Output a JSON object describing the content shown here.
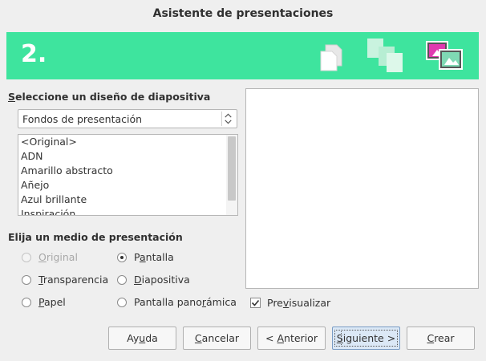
{
  "window": {
    "title": "Asistente de presentaciones"
  },
  "banner": {
    "step": "2.",
    "color": "#3ee49e",
    "icons": [
      "single-page-icon",
      "multiple-pages-icon",
      "image-slides-icon"
    ]
  },
  "design": {
    "label_mnemonic": "S",
    "label_rest": "eleccione un diseño de diapositiva",
    "select_value": "Fondos de presentación",
    "list_items": [
      "<Original>",
      "ADN",
      "Amarillo abstracto",
      "Añejo",
      "Azul brillante",
      "Inspiración"
    ]
  },
  "medium": {
    "label": "Elija un medio de presentación",
    "options": [
      {
        "pre": "",
        "mn": "O",
        "post": "riginal",
        "selected": false,
        "disabled": true
      },
      {
        "pre": "",
        "mn": "T",
        "post": "ransparencia",
        "selected": false,
        "disabled": false
      },
      {
        "pre": "",
        "mn": "P",
        "post": "apel",
        "selected": false,
        "disabled": false
      },
      {
        "pre": "P",
        "mn": "a",
        "post": "ntalla",
        "selected": true,
        "disabled": false
      },
      {
        "pre": "",
        "mn": "D",
        "post": "iapositiva",
        "selected": false,
        "disabled": false
      },
      {
        "pre": "Pantalla pano",
        "mn": "r",
        "post": "ámica",
        "selected": false,
        "disabled": false
      }
    ]
  },
  "preview": {
    "checkbox_pre": "Pre",
    "checkbox_mn": "v",
    "checkbox_post": "isualizar",
    "checked": true
  },
  "buttons": {
    "help_pre": "Ay",
    "help_mn": "u",
    "help_post": "da",
    "cancel_mn": "C",
    "cancel_post": "ancelar",
    "back_pre": "< ",
    "back_mn": "A",
    "back_post": "nterior",
    "next_mn": "S",
    "next_post": "iguiente >",
    "create_mn": "C",
    "create_post": "rear"
  }
}
